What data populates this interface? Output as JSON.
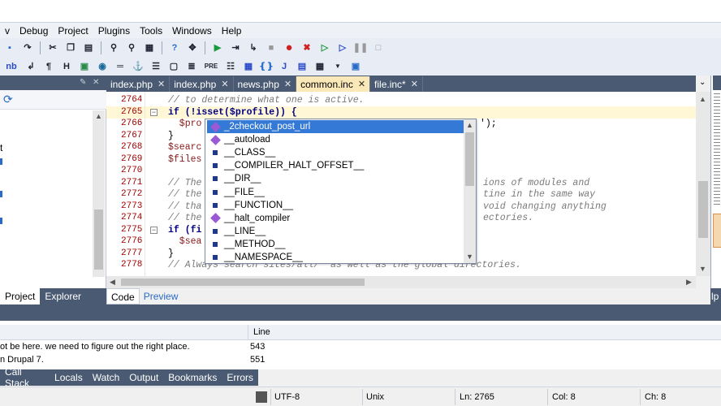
{
  "menu": [
    "v",
    "Debug",
    "Project",
    "Plugins",
    "Tools",
    "Windows",
    "Help"
  ],
  "toolbar1": [
    "new",
    "redo",
    "cut",
    "copy",
    "paste",
    "find",
    "find-next",
    "replace",
    "help",
    "fit",
    "run",
    "step-into",
    "step-over",
    "pause-small",
    "breakpoint",
    "clear-breakpoints",
    "run-green",
    "run-blue",
    "pause",
    "stop"
  ],
  "toolbar2": {
    "nb": "nb",
    "para": "¶",
    "h": "H",
    "pre": "PRE",
    "j": "J"
  },
  "tabs": [
    {
      "label": "index.php",
      "close": "✕"
    },
    {
      "label": "index.php",
      "close": "✕"
    },
    {
      "label": "news.php",
      "close": "✕"
    },
    {
      "label": "common.inc",
      "close": "✕"
    },
    {
      "label": "file.inc*",
      "close": "✕"
    }
  ],
  "code_lines": [
    {
      "n": "2764",
      "text": "// to determine what one is active."
    },
    {
      "n": "2765",
      "text": "if (!isset($profile)) {"
    },
    {
      "n": "2766",
      "text": "  $pro"
    },
    {
      "n": "2767",
      "text": "}"
    },
    {
      "n": "2768",
      "text": "$searc"
    },
    {
      "n": "2769",
      "text": "$files"
    },
    {
      "n": "2770",
      "text": ""
    },
    {
      "n": "2771",
      "text": "// The"
    },
    {
      "n": "2772",
      "text": "// the"
    },
    {
      "n": "2773",
      "text": "// tha"
    },
    {
      "n": "2774",
      "text": "// the"
    },
    {
      "n": "2775",
      "text": "if (fi"
    },
    {
      "n": "2776",
      "text": "  $sea"
    },
    {
      "n": "2777",
      "text": "}"
    },
    {
      "n": "2778",
      "text": "// Always search sites/all/* as well as the global directories."
    }
  ],
  "code_right": [
    {
      "line": 2,
      "text": "');"
    },
    {
      "line": 7,
      "text": "ions of modules and"
    },
    {
      "line": 8,
      "text": "tine in the same way"
    },
    {
      "line": 9,
      "text": "void changing anything"
    },
    {
      "line": 10,
      "text": "ectories."
    }
  ],
  "autocomplete": [
    {
      "label": "_2checkout_post_url",
      "kind": "function",
      "selected": true
    },
    {
      "label": "__autoload",
      "kind": "function"
    },
    {
      "label": "__CLASS__",
      "kind": "constant"
    },
    {
      "label": "__COMPILER_HALT_OFFSET__",
      "kind": "constant"
    },
    {
      "label": "__DIR__",
      "kind": "constant"
    },
    {
      "label": "__FILE__",
      "kind": "constant"
    },
    {
      "label": "__FUNCTION__",
      "kind": "constant"
    },
    {
      "label": "__halt_compiler",
      "kind": "function"
    },
    {
      "label": "__LINE__",
      "kind": "constant"
    },
    {
      "label": "__METHOD__",
      "kind": "constant"
    },
    {
      "label": "__NAMESPACE__",
      "kind": "constant"
    }
  ],
  "left_tree_fragments": [
    "t"
  ],
  "left_tabs": [
    "Project",
    "Explorer"
  ],
  "editor_tabs": [
    "Code",
    "Preview"
  ],
  "results": {
    "line_header": "Line",
    "rows": [
      {
        "text": "ot be here. we need to figure out the right place.",
        "line": "543"
      },
      {
        "text": "n Drupal 7.",
        "line": "551"
      }
    ]
  },
  "bottom_tabs": [
    "Call Stack",
    "Locals",
    "Watch",
    "Output",
    "Bookmarks",
    "Errors"
  ],
  "status": {
    "encoding": "UTF-8",
    "eol": "Unix",
    "ln": "Ln: 2765",
    "col": "Col: 8",
    "ch": "Ch: 8"
  },
  "right_edge_label": "lp",
  "colors": {
    "accent": "#3579d6",
    "dark_panel": "#4a5a72",
    "active_tab": "#fbe8b8",
    "line_number": "#a00000"
  }
}
